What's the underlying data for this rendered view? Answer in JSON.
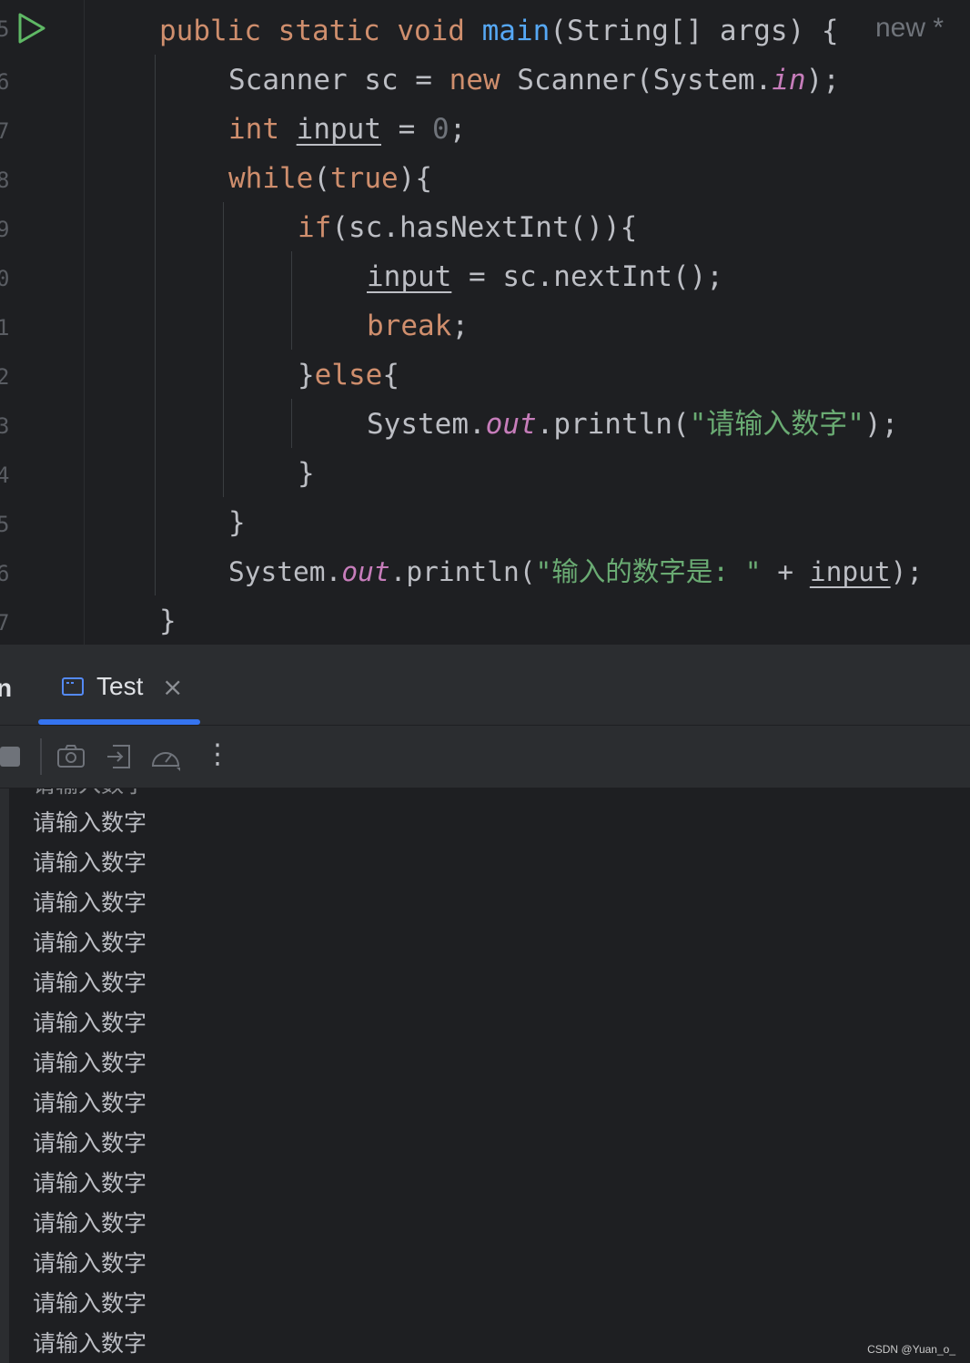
{
  "editor": {
    "line_numbers": [
      "5",
      "6",
      "7",
      "8",
      "9",
      "0",
      "1",
      "2",
      "3",
      "4",
      "5",
      "6",
      "7"
    ],
    "code": {
      "l1": {
        "kw1": "public",
        "kw2": "static",
        "kw3": "void",
        "name": "main",
        "rest": "(String[] args) {",
        "hint": "new *"
      },
      "l2": {
        "a": "Scanner sc = ",
        "kw": "new",
        "b": " Scanner(System.",
        "static": "in",
        "c": ");"
      },
      "l3": {
        "kw": "int",
        "var": "input",
        "b": " = ",
        "num": "0",
        "c": ";"
      },
      "l4": {
        "kw": "while",
        "a": "(",
        "kw2": "true",
        "b": "){"
      },
      "l5": {
        "kw": "if",
        "a": "(sc.hasNextInt()){"
      },
      "l6": {
        "var": "input",
        "a": " = sc.nextInt();"
      },
      "l7": {
        "kw": "break",
        "a": ";"
      },
      "l8": {
        "a": "}",
        "kw": "else",
        "b": "{"
      },
      "l9": {
        "a": "System.",
        "static": "out",
        "b": ".println(",
        "str": "\"请输入数字\"",
        "c": ");"
      },
      "l10": {
        "a": "}"
      },
      "l11": {
        "a": "}"
      },
      "l12": {
        "a": "System.",
        "static": "out",
        "b": ".println(",
        "str": "\"输入的数字是: \"",
        "c": " + ",
        "var": "input",
        "d": ");"
      },
      "l13": {
        "a": "}"
      }
    }
  },
  "run_panel": {
    "prev_tab_fragment": "n",
    "tab_label": "Test",
    "tab_close": "×",
    "toolbar_more": "⋮"
  },
  "console": {
    "lines": [
      "请输入数字",
      "请输入数字",
      "请输入数字",
      "请输入数字",
      "请输入数字",
      "请输入数字",
      "请输入数字",
      "请输入数字",
      "请输入数字",
      "请输入数字",
      "请输入数字",
      "请输入数字",
      "请输入数字",
      "请输入数字"
    ]
  },
  "watermark": "CSDN @Yuan_o_",
  "colors": {
    "background": "#1e1f22",
    "keyword": "#cf8e6d",
    "function": "#56a8f5",
    "string": "#6aab73",
    "static_field": "#c77dbb",
    "number": "#2aacb8",
    "accent": "#3574f0",
    "run_icon": "#5fb865"
  }
}
